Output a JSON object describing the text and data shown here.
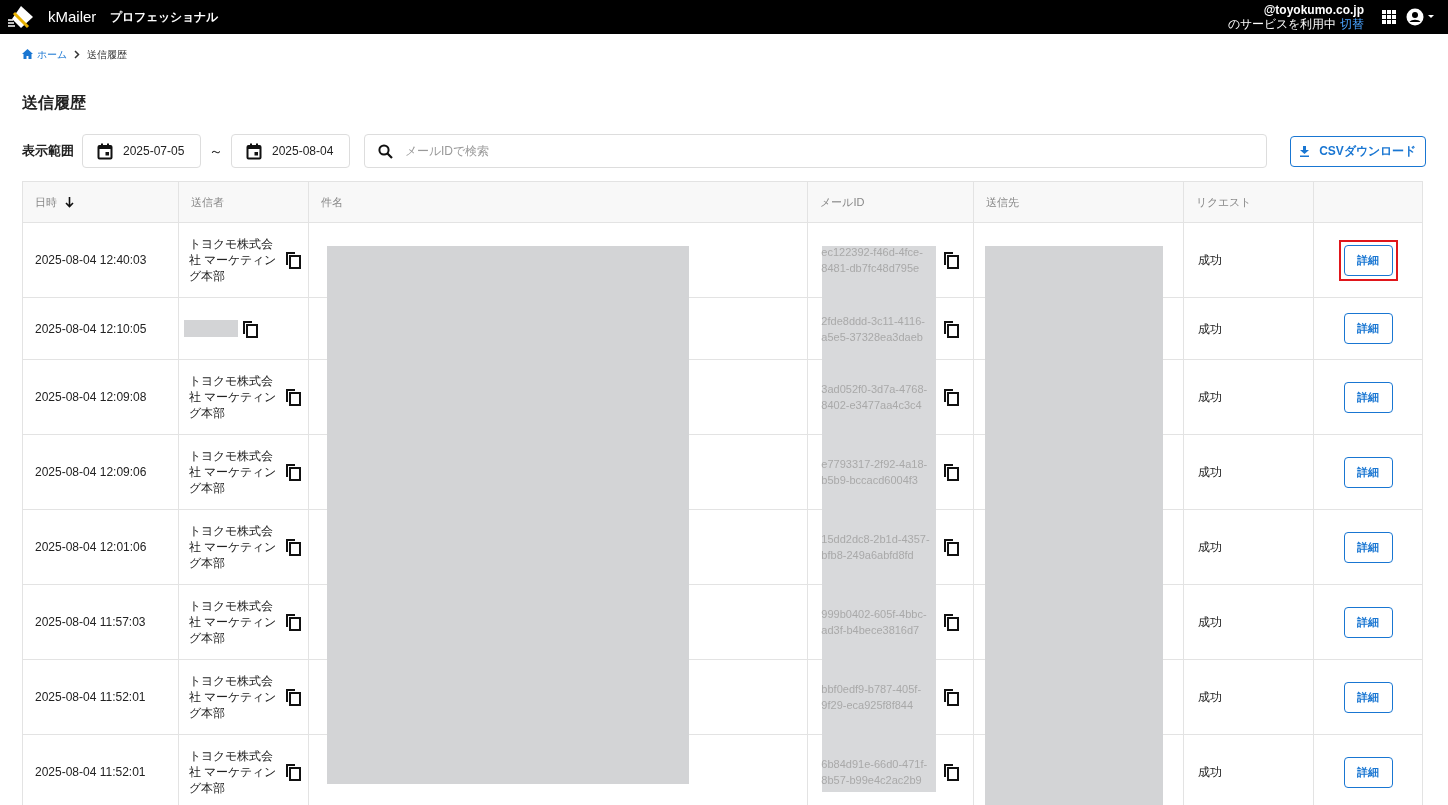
{
  "header": {
    "app_name": "kMailer",
    "edition": "プロフェッショナル",
    "account": "@toyokumo.co.jp",
    "service_note": "のサービスを利用中",
    "switch_link": "切替"
  },
  "breadcrumb": [
    {
      "label": "ホーム",
      "kind": "home"
    },
    {
      "label": "送信履歴",
      "kind": "current"
    }
  ],
  "page_title": "送信履歴",
  "filters": {
    "range_label": "表示範囲",
    "start_date": "2025-07-05",
    "separator": "～",
    "end_date": "2025-08-04",
    "search": {
      "placeholder": "メールIDで検索"
    },
    "csv_button": "CSVダウンロード"
  },
  "table": {
    "columns": [
      {
        "label": "日時",
        "sorted": true
      },
      {
        "label": "送信者",
        "sorted": false
      },
      {
        "label": "件名",
        "sorted": false
      },
      {
        "label": "メールID",
        "sorted": false
      },
      {
        "label": "送信先",
        "sorted": false
      },
      {
        "label": "リクエスト",
        "sorted": false
      }
    ],
    "rows": [
      {
        "datetime": "2025-08-04 12:40:03",
        "sender": {
          "kind": "text",
          "text": "トヨクモ株式会社 マーケティング本部"
        },
        "mail_id": "ec122392-f46d-4fce-8481-db7fc48d795e",
        "request": "成功",
        "action": "詳細",
        "highlighted": true
      },
      {
        "datetime": "2025-08-04 12:10:05",
        "sender": {
          "kind": "redacted"
        },
        "mail_id": "2fde8ddd-3c11-4116-a5e5-37328ea3daeb",
        "request": "成功",
        "action": "詳細",
        "highlighted": false
      },
      {
        "datetime": "2025-08-04 12:09:08",
        "sender": {
          "kind": "text",
          "text": "トヨクモ株式会社 マーケティング本部"
        },
        "mail_id": "3ad052f0-3d7a-4768-8402-e3477aa4c3c4",
        "request": "成功",
        "action": "詳細",
        "highlighted": false
      },
      {
        "datetime": "2025-08-04 12:09:06",
        "sender": {
          "kind": "text",
          "text": "トヨクモ株式会社 マーケティング本部"
        },
        "mail_id": "e7793317-2f92-4a18-b5b9-bccacd6004f3",
        "request": "成功",
        "action": "詳細",
        "highlighted": false
      },
      {
        "datetime": "2025-08-04 12:01:06",
        "sender": {
          "kind": "text",
          "text": "トヨクモ株式会社 マーケティング本部"
        },
        "mail_id": "15dd2dc8-2b1d-4357-bfb8-249a6abfd8fd",
        "request": "成功",
        "action": "詳細",
        "highlighted": false
      },
      {
        "datetime": "2025-08-04 11:57:03",
        "sender": {
          "kind": "text",
          "text": "トヨクモ株式会社 マーケティング本部"
        },
        "mail_id": "999b0402-605f-4bbc-ad3f-b4bece3816d7",
        "request": "成功",
        "action": "詳細",
        "highlighted": false
      },
      {
        "datetime": "2025-08-04 11:52:01",
        "sender": {
          "kind": "text",
          "text": "トヨクモ株式会社 マーケティング本部"
        },
        "mail_id": "bbf0edf9-b787-405f-9f29-eca925f8f844",
        "request": "成功",
        "action": "詳細",
        "highlighted": false
      },
      {
        "datetime": "2025-08-04 11:52:01",
        "sender": {
          "kind": "text",
          "text": "トヨクモ株式会社 マーケティング本部"
        },
        "mail_id": "6b84d91e-66d0-471f-8b57-b99e4c2ac2b9",
        "request": "成功",
        "action": "詳細",
        "highlighted": false
      }
    ]
  }
}
